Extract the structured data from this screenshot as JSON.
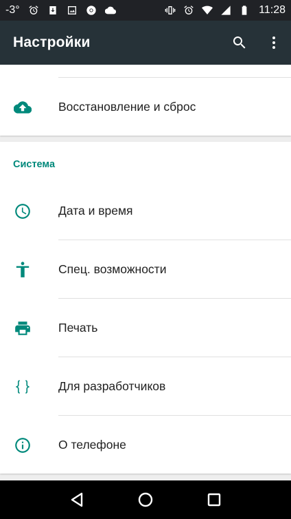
{
  "status_bar": {
    "temperature": "-3°",
    "time": "11:28",
    "icons_left": [
      "temperature",
      "alarm-icon",
      "download-icon",
      "image-icon",
      "chrome-icon",
      "cloud-icon"
    ],
    "icons_right": [
      "vibrate-icon",
      "alarm-icon",
      "wifi-icon",
      "signal-icon",
      "battery-icon"
    ]
  },
  "app_bar": {
    "title": "Настройки",
    "actions": [
      "search-icon",
      "more-vert-icon"
    ]
  },
  "card1": {
    "items": [
      {
        "label": "Восстановление и сброс",
        "icon": "cloud-upload-icon"
      }
    ]
  },
  "system_section": {
    "header": "Система",
    "items": [
      {
        "label": "Дата и время",
        "icon": "clock-icon"
      },
      {
        "label": "Спец. возможности",
        "icon": "accessibility-icon"
      },
      {
        "label": "Печать",
        "icon": "printer-icon"
      },
      {
        "label": "Для разработчиков",
        "icon": "braces-icon"
      },
      {
        "label": "О телефоне",
        "icon": "info-icon"
      }
    ]
  },
  "nav_bar": {
    "buttons": [
      "back-icon",
      "home-icon",
      "recents-icon"
    ]
  },
  "colors": {
    "accent": "#00897b",
    "app_bar": "#263238",
    "status_bar": "#202226"
  }
}
